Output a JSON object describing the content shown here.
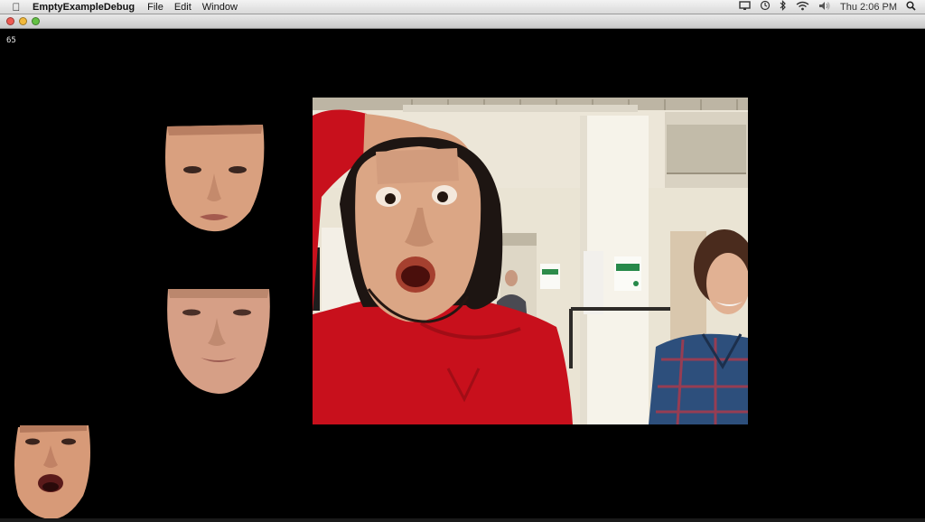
{
  "menubar": {
    "app_name": "EmptyExampleDebug",
    "menus": [
      "File",
      "Edit",
      "Window"
    ],
    "clock": "Thu 2:06 PM",
    "status_icons": [
      "display-icon",
      "time-machine-icon",
      "bluetooth-icon",
      "wifi-icon",
      "volume-icon",
      "spotlight-icon"
    ]
  },
  "canvas": {
    "frame_counter": "65"
  },
  "colors": {
    "background": "#000000",
    "hoodie_red": "#c8101c",
    "skin": "#dca88a",
    "flannel": "#2d4f7c"
  }
}
